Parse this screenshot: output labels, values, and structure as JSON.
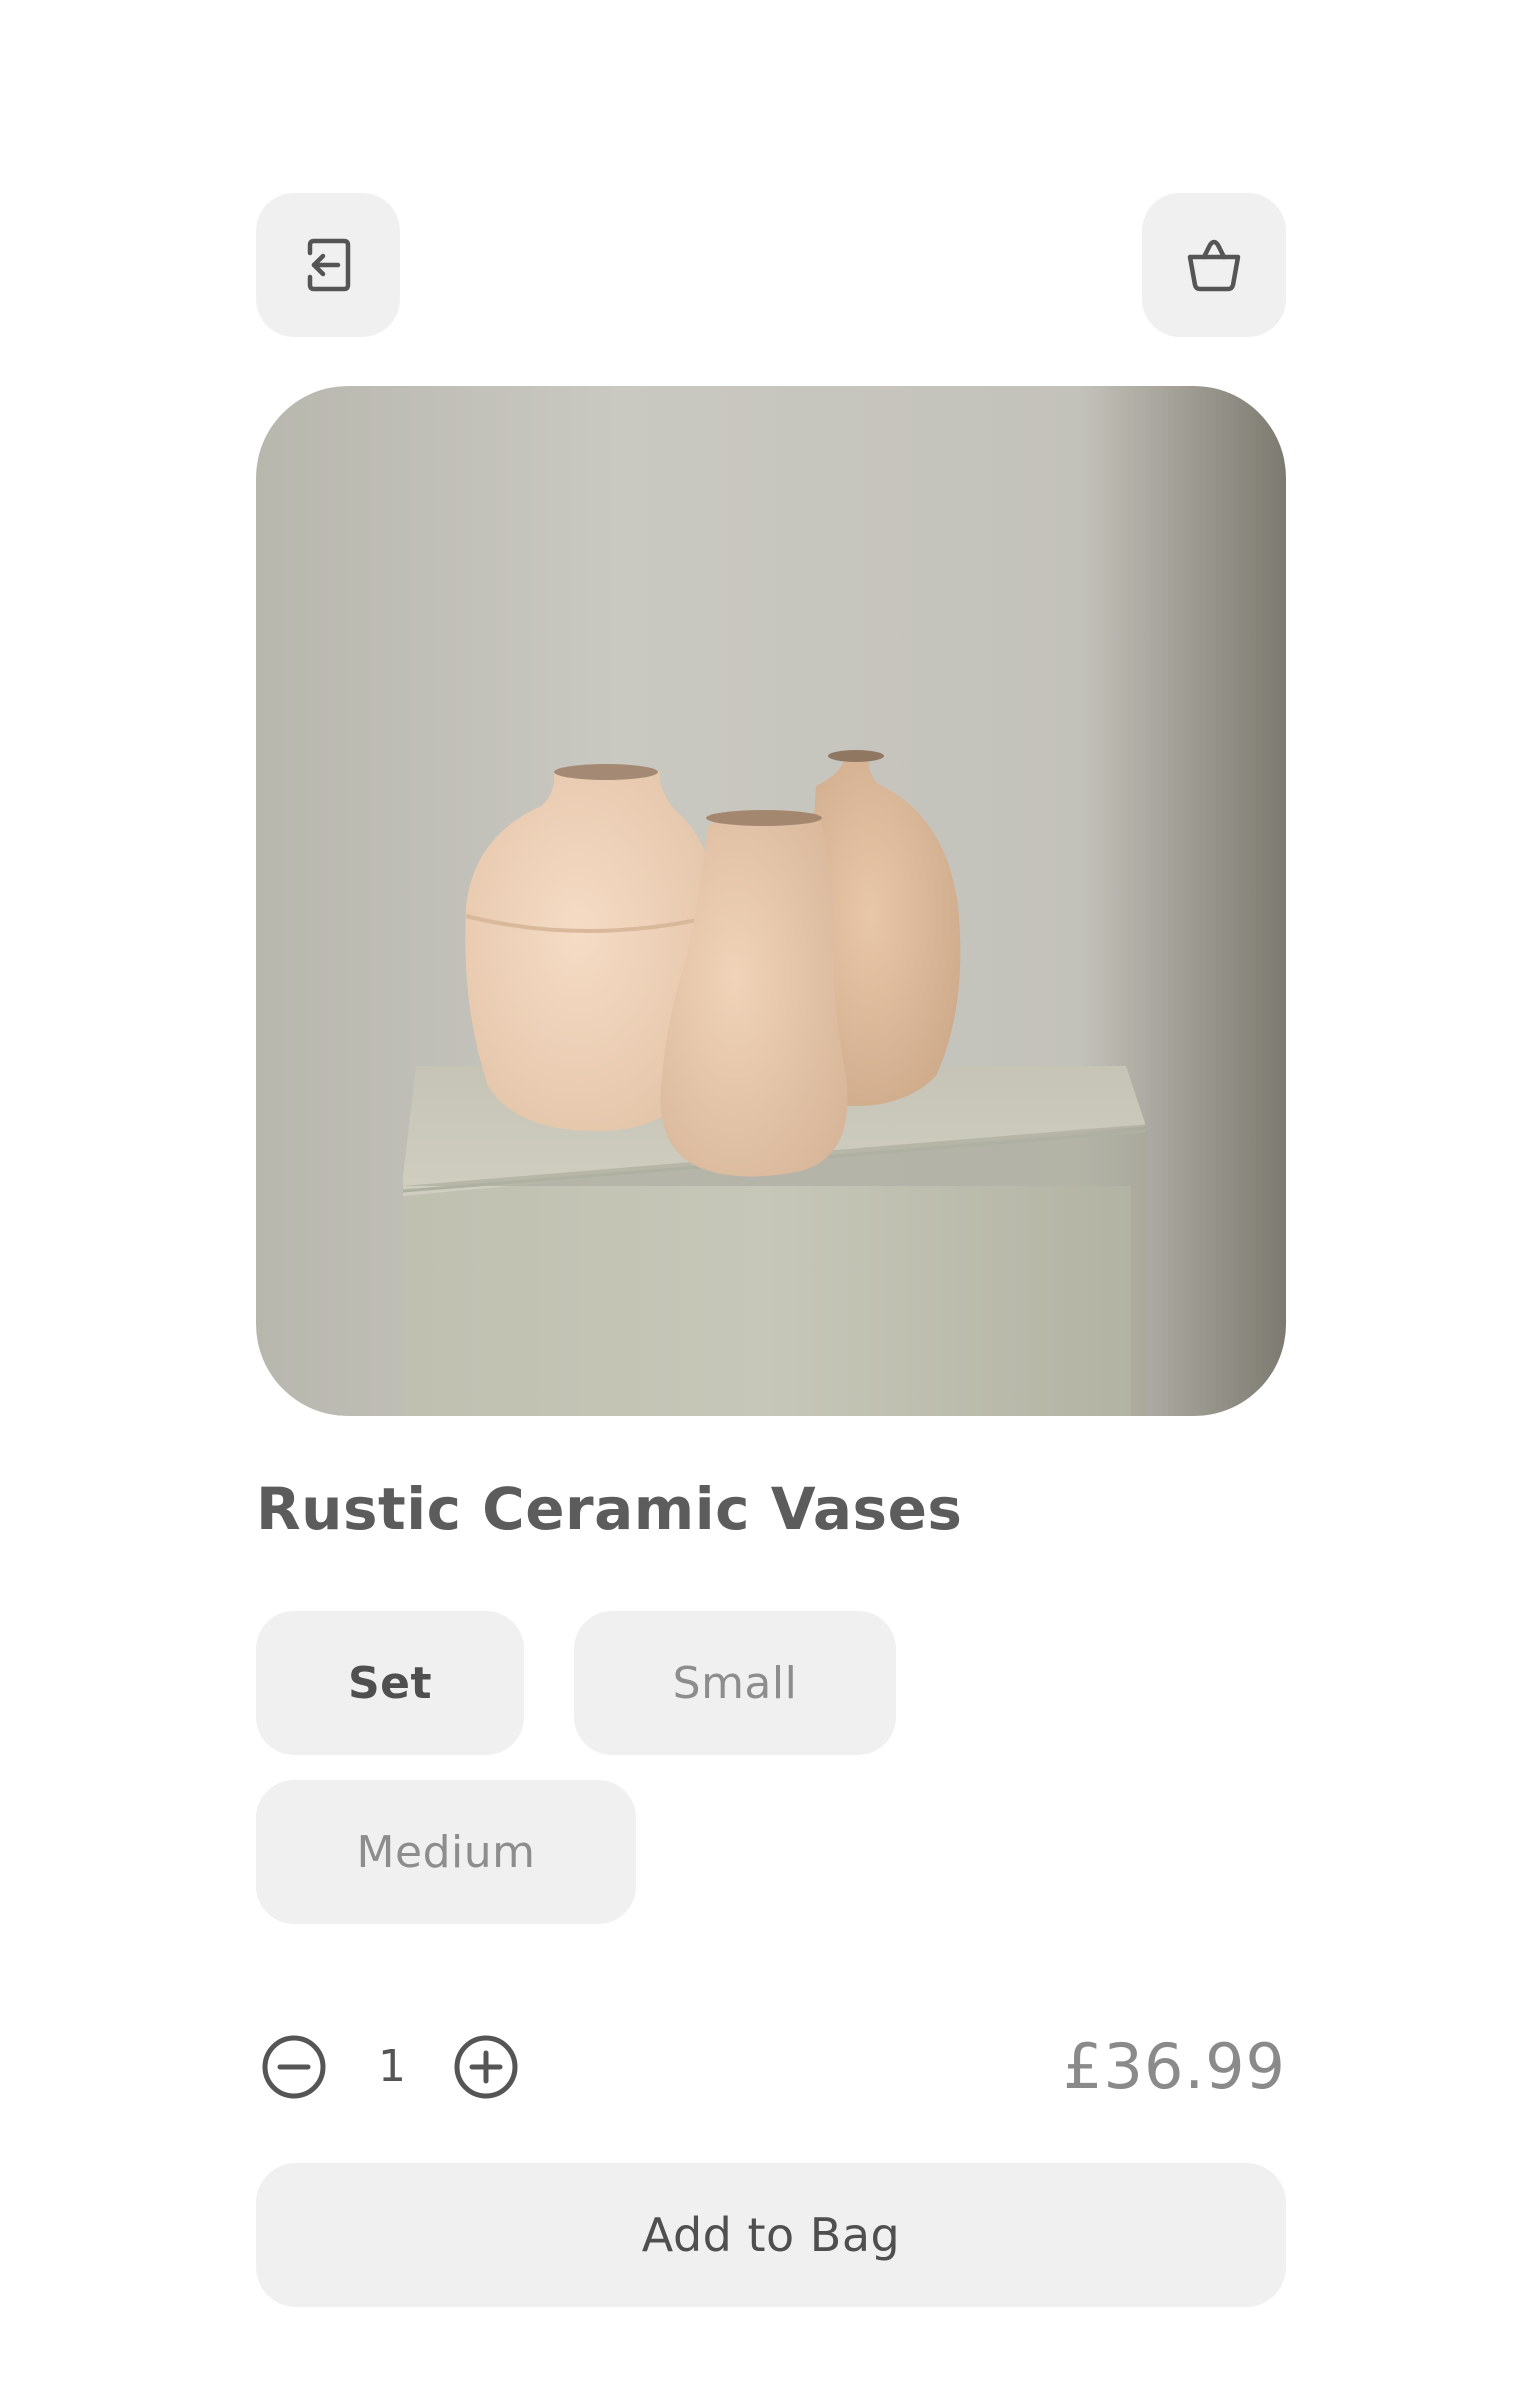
{
  "header": {
    "back_icon": "exit-arrow-left-icon",
    "bag_icon": "shopping-bag-icon"
  },
  "product": {
    "title": "Rustic Ceramic Vases",
    "image_alt": "Three rustic ceramic vases on a plaster plinth",
    "price": "£36.99"
  },
  "variants": [
    {
      "label": "Set",
      "selected": true
    },
    {
      "label": "Small",
      "selected": false
    },
    {
      "label": "Medium",
      "selected": false
    }
  ],
  "quantity": {
    "value": "1",
    "minus_icon": "minus-circle-icon",
    "plus_icon": "plus-circle-icon"
  },
  "actions": {
    "add_to_bag_label": "Add to Bag"
  },
  "colors": {
    "button_bg": "#f0f0f0",
    "text_primary": "#5c5c5c",
    "text_muted": "#8d8d8d"
  }
}
